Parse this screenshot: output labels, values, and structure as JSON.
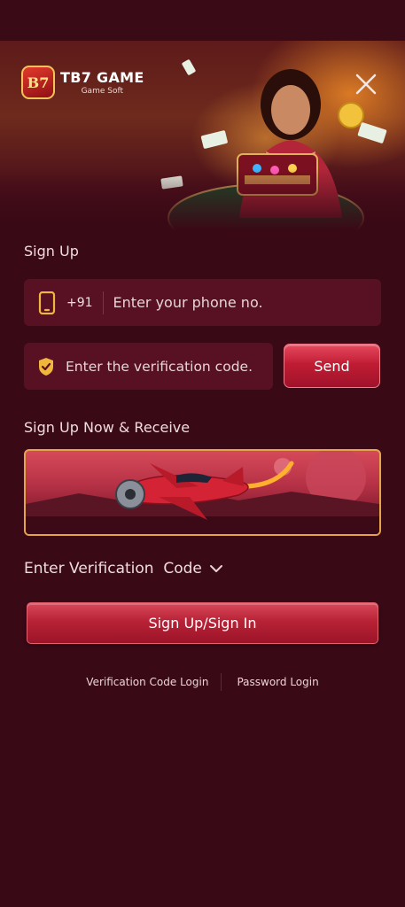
{
  "app": {
    "logo_mark": "B7",
    "logo_title": "TB7 GAME",
    "logo_subtitle": "Game Soft"
  },
  "signup": {
    "title": "Sign Up",
    "country_code": "+91",
    "phone_placeholder": "Enter your phone no.",
    "code_placeholder": "Enter the verification code.",
    "send_label": "Send"
  },
  "promo": {
    "title": "Sign Up Now & Receive"
  },
  "verification": {
    "toggle_label": "Enter Verification  Code"
  },
  "actions": {
    "primary_label": "Sign Up/Sign In",
    "verification_login": "Verification Code Login",
    "password_login": "Password Login"
  },
  "colors": {
    "background": "#3a0916",
    "input_bg": "#571123",
    "accent_red": "#c01d34",
    "promo_border": "#e6a44a"
  }
}
